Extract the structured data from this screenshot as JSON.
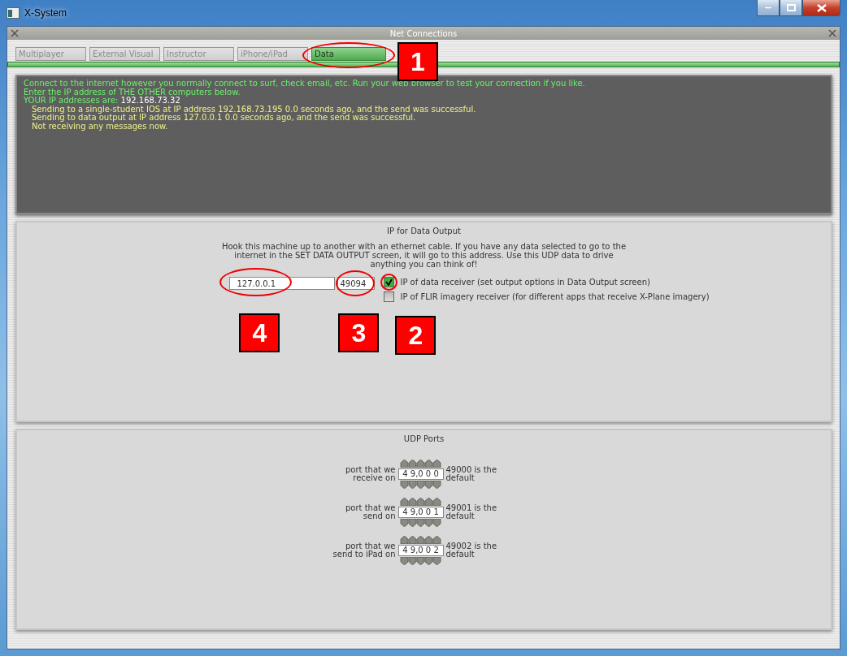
{
  "window": {
    "title": "X-System"
  },
  "panel": {
    "title": "Net Connections"
  },
  "tabs": [
    {
      "label": "Multiplayer",
      "selected": false
    },
    {
      "label": "External Visual",
      "selected": false
    },
    {
      "label": "Instructor",
      "selected": false
    },
    {
      "label": "iPhone/iPad",
      "selected": false
    },
    {
      "label": "Data",
      "selected": true,
      "callout": "1"
    }
  ],
  "messages": [
    {
      "kind": "info",
      "text": "Connect to the internet however you normally connect to surf, check email, etc. Run your web browser to test your connection if you like."
    },
    {
      "kind": "info",
      "text": "Enter the IP address of THE OTHER computers below."
    },
    {
      "kind": "address",
      "text": "YOUR IP addresses are:",
      "value": "192.168.73.32"
    },
    {
      "kind": "status",
      "text": "Sending to  a single-student IOS at IP address 192.168.73.195  0.0 seconds ago,  and the send was successful."
    },
    {
      "kind": "status",
      "text": "Sending to  data output at IP address 127.0.0.1  0.0 seconds ago,  and the send was successful."
    },
    {
      "kind": "status",
      "text": "Not receiving any messages now."
    }
  ],
  "data_output": {
    "title": "IP for Data Output",
    "description": "Hook this machine up to another with an ethernet cable. If you have any data selected to go to the internet in the SET DATA OUTPUT screen, it will go to this address. Use this UDP data to drive anything you can think of!",
    "ip": "127.0.0.1",
    "ip_callout": "4",
    "port": "49094",
    "port_callout": "3",
    "options": [
      {
        "label": "IP of data receiver (set output options in Data Output screen)",
        "checked": true,
        "callout": "2"
      },
      {
        "label": "IP of FLIR imagery receiver (for different apps that receive X-Plane imagery)",
        "checked": false
      }
    ]
  },
  "udp_ports": {
    "title": "UDP Ports",
    "ports": [
      {
        "label": "port that we receive on",
        "value": "4 9,0 0 0",
        "note": "49000 is the default"
      },
      {
        "label": "port that we send on",
        "value": "4 9,0 0 1",
        "note": "49001 is the default"
      },
      {
        "label": "port that we send to iPad on",
        "value": "4 9,0 0 2",
        "note": "49002 is the default"
      }
    ]
  }
}
